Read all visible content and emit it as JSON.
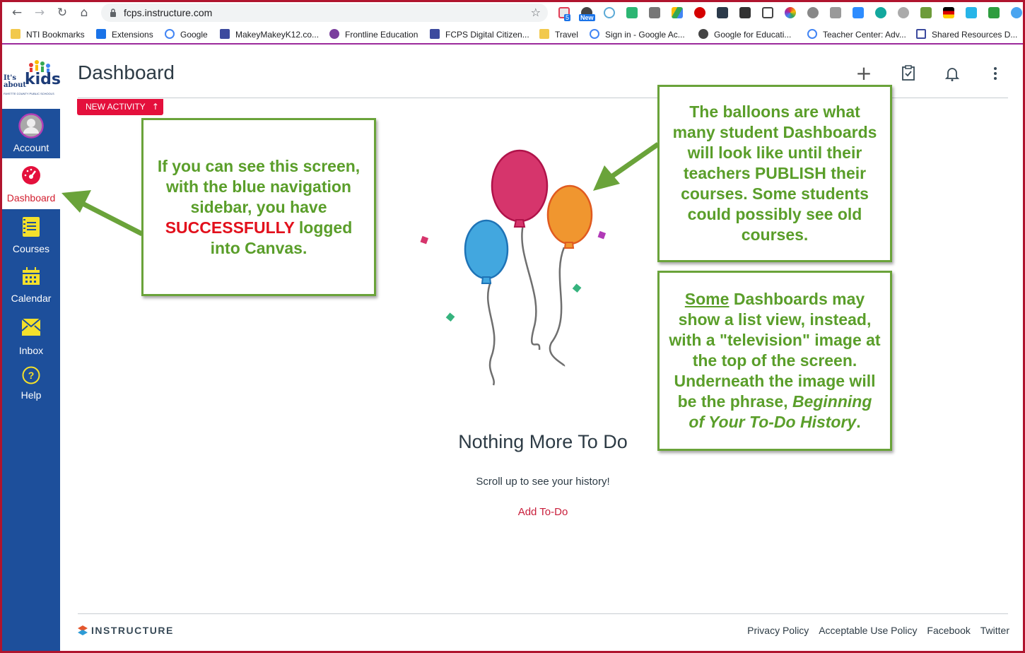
{
  "browser": {
    "url": "fcps.instructure.com",
    "ext_badges": {
      "badge_5": "5",
      "badge_new": "New"
    },
    "bookmarks": [
      "NTI Bookmarks",
      "Extensions",
      "Google",
      "MakeyMakeyK12.co...",
      "Frontline Education",
      "FCPS Digital Citizen...",
      "Travel",
      "Sign in - Google Ac...",
      "Google for Educati...",
      "Teacher Center: Adv...",
      "Shared Resources D..."
    ]
  },
  "logo": {
    "line1": "It's",
    "line2": "about",
    "word": "kids",
    "tagline": "FAYETTE COUNTY PUBLIC SCHOOLS"
  },
  "nav": {
    "account": "Account",
    "dashboard": "Dashboard",
    "courses": "Courses",
    "calendar": "Calendar",
    "inbox": "Inbox",
    "help": "Help"
  },
  "page": {
    "title": "Dashboard",
    "new_activity": "NEW ACTIVITY",
    "nothing_title": "Nothing More To Do",
    "scroll_text": "Scroll up to see your history!",
    "add_todo": "Add To-Do"
  },
  "footer": {
    "brand": "INSTRUCTURE",
    "links": [
      "Privacy Policy",
      "Acceptable Use Policy",
      "Facebook",
      "Twitter"
    ]
  },
  "notes": {
    "left": {
      "a": "If you can see this screen, with the blue navigation sidebar, you have",
      "b": "SUCCESSFULLY",
      "c": "logged into Canvas."
    },
    "right_top": "The balloons are what many student Dashboards will look like until their teachers PUBLISH their courses. Some students could possibly see old courses.",
    "right_bottom": {
      "a": "Some",
      "b": "Dashboards may show a list view, instead, with a \"television\" image at the top of the screen. Underneath the image will be the phrase,",
      "c": "Beginning of Your To-Do History",
      "d": "."
    }
  },
  "colors": {
    "nav_blue": "#1d4f9b",
    "canvas_red": "#e4103c",
    "note_green": "#5a9e2a",
    "frame": "#b0142e"
  }
}
